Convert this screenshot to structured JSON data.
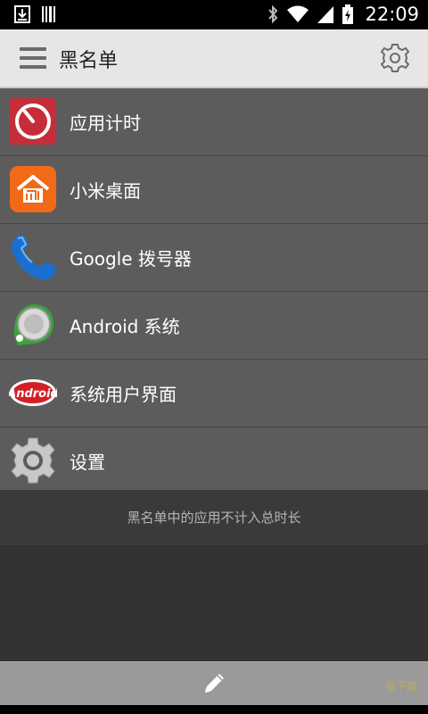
{
  "status_bar": {
    "time": "22:09",
    "icons": [
      "download-icon",
      "barcode-icon",
      "bluetooth-icon",
      "wifi-icon",
      "signal-icon",
      "battery-charging-icon"
    ]
  },
  "action_bar": {
    "title": "黑名单",
    "menu_icon": "hamburger-menu-icon",
    "settings_icon": "gear-icon"
  },
  "apps": [
    {
      "label": "应用计时",
      "icon": "timer-app-icon"
    },
    {
      "label": "小米桌面",
      "icon": "mi-home-icon"
    },
    {
      "label": "Google 拨号器",
      "icon": "phone-dialer-icon"
    },
    {
      "label": "Android 系统",
      "icon": "android-system-icon"
    },
    {
      "label": "系统用户界面",
      "icon": "android-kitkat-icon"
    },
    {
      "label": "设置",
      "icon": "settings-gear-icon"
    }
  ],
  "footer_note": "黑名单中的应用不计入总时长",
  "bottom_bar": {
    "edit_icon": "pencil-icon"
  },
  "watermark": "盘下载",
  "colors": {
    "action_bar": "#e6e6e6",
    "list_bg": "#5c5c5c",
    "screen_bg": "#333333",
    "bottom_bar": "#9a9a9a"
  }
}
